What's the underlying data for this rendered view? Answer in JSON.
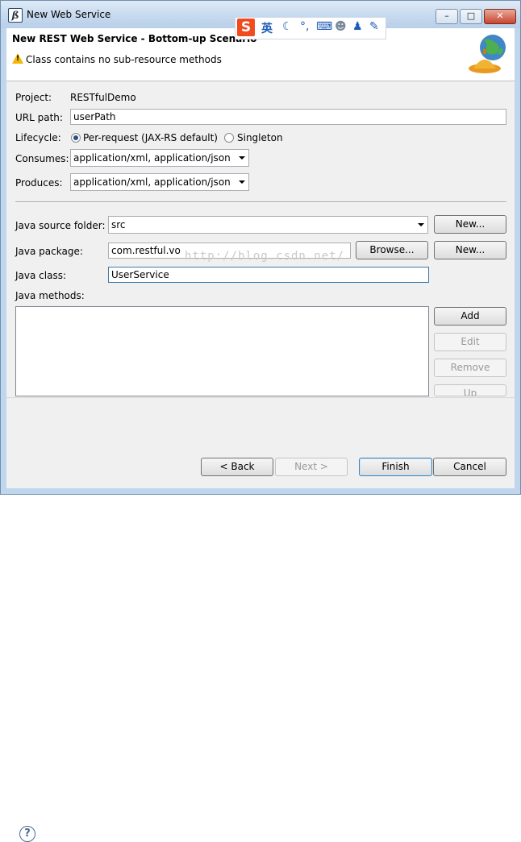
{
  "window": {
    "title": "New Web Service",
    "controls": {
      "minimize": "–",
      "maximize": "□",
      "close": "✕"
    }
  },
  "ime_toolbar": {
    "logo": "S",
    "mode": "英",
    "items": [
      "moon-icon",
      "punctuation-icon",
      "keyboard-icon",
      "user-icon",
      "skin-icon",
      "tools-icon"
    ]
  },
  "header": {
    "title": "New REST Web Service - Bottom-up Scenario",
    "message": "Class contains no sub-resource methods"
  },
  "form": {
    "project_label": "Project:",
    "project_value": "RESTfulDemo",
    "url_path_label": "URL path:",
    "url_path_value": "userPath",
    "lifecycle_label": "Lifecycle:",
    "lifecycle_options": [
      "Per-request (JAX-RS default)",
      "Singleton"
    ],
    "lifecycle_selected": "Per-request (JAX-RS default)",
    "consumes_label": "Consumes:",
    "consumes_value": "application/xml, application/json",
    "produces_label": "Produces:",
    "produces_value": "application/xml, application/json",
    "source_folder_label": "Java source folder:",
    "source_folder_value": "src",
    "package_label": "Java package:",
    "package_value": "com.restful.vo",
    "class_label": "Java class:",
    "class_value": "UserService",
    "methods_label": "Java methods:"
  },
  "buttons": {
    "new_folder": "New...",
    "browse": "Browse...",
    "new_package": "New...",
    "add": "Add",
    "edit": "Edit",
    "remove": "Remove",
    "up": "Up",
    "back": "< Back",
    "next": "Next >",
    "finish": "Finish",
    "cancel": "Cancel"
  },
  "watermark": "http://blog.csdn.net/",
  "help": "?"
}
